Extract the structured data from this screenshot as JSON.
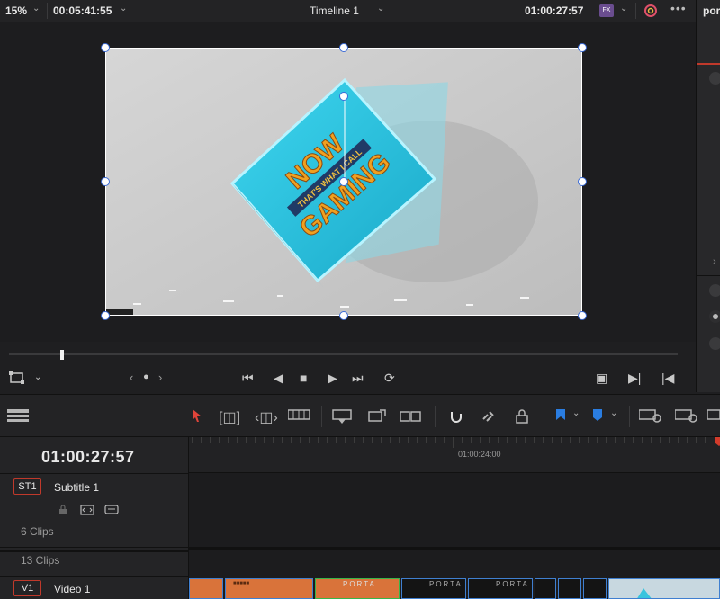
{
  "viewer_bar": {
    "zoom": "15%",
    "source_timecode": "00:05:41:55",
    "timeline_name": "Timeline 1",
    "record_timecode": "01:00:27:57",
    "fx_badge": "FX"
  },
  "right_panel": {
    "title": "por"
  },
  "frame": {
    "caption_line1": "NOW",
    "caption_line2": "THAT'S WHAT I CALL",
    "caption_line3": "GAMING"
  },
  "timeline": {
    "current_timecode": "01:00:27:57",
    "ruler_label": "01:00:24:00",
    "tracks": [
      {
        "id": "ST1",
        "name": "Subtitle 1",
        "clips_label": "6 Clips"
      },
      {
        "id": "V1",
        "name": "Video 1",
        "clips_label": "13 Clips"
      }
    ],
    "clip_texts": [
      "PORTA",
      "PORTA",
      "PORTA"
    ]
  },
  "colors": {
    "accent_red": "#c0392b",
    "clip_border": "#3f7fd0",
    "clip_green": "#39b54a",
    "flag_blue": "#2a7de1"
  },
  "icons": [
    "chevron-down-icon",
    "color-wheel-icon",
    "more-icon",
    "transform-icon",
    "skip-start-icon",
    "step-back-icon",
    "stop-icon",
    "play-icon",
    "skip-end-icon",
    "loop-icon",
    "select-icon",
    "trim-icon",
    "blade-icon",
    "snap-icon",
    "link-icon",
    "lock-icon",
    "flag-icon",
    "marker-icon",
    "zoom-icon"
  ]
}
